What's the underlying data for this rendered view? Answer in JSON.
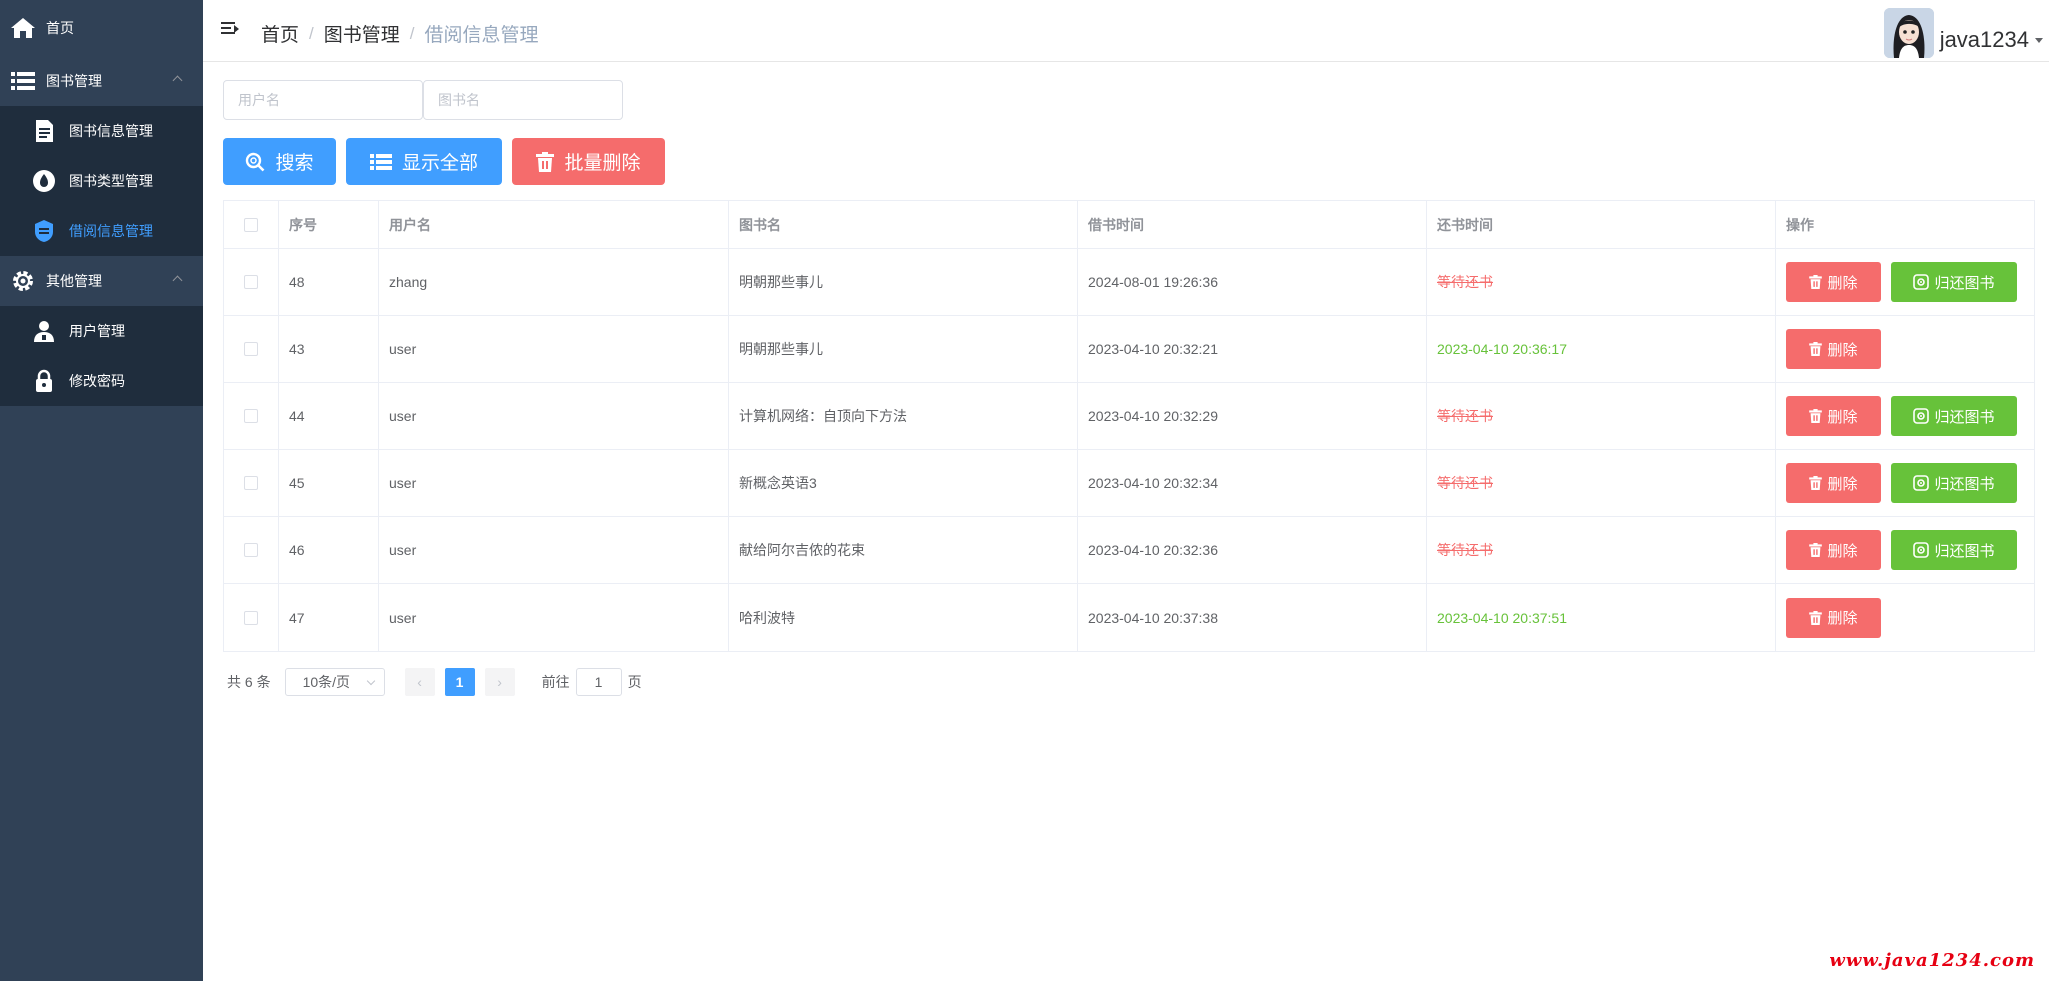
{
  "sidebar": {
    "items": [
      {
        "label": "首页"
      },
      {
        "label": "图书管理"
      },
      {
        "label": "图书信息管理"
      },
      {
        "label": "图书类型管理"
      },
      {
        "label": "借阅信息管理"
      },
      {
        "label": "其他管理"
      },
      {
        "label": "用户管理"
      },
      {
        "label": "修改密码"
      }
    ]
  },
  "header": {
    "breadcrumb": [
      "首页",
      "图书管理",
      "借阅信息管理"
    ],
    "separator": "/",
    "username": "java1234"
  },
  "filters": {
    "username_placeholder": "用户名",
    "bookname_placeholder": "图书名"
  },
  "toolbar": {
    "search_label": "搜索",
    "show_all_label": "显示全部",
    "batch_delete_label": "批量删除"
  },
  "table": {
    "headers": [
      "序号",
      "用户名",
      "图书名",
      "借书时间",
      "还书时间",
      "操作"
    ],
    "rows": [
      {
        "id": "48",
        "user": "zhang",
        "book": "明朝那些事儿",
        "borrow": "2024-08-01 19:26:36",
        "return": "等待还书"
      },
      {
        "id": "43",
        "user": "user",
        "book": "明朝那些事儿",
        "borrow": "2023-04-10 20:32:21",
        "return": "2023-04-10 20:36:17"
      },
      {
        "id": "44",
        "user": "user",
        "book": "计算机网络：自顶向下方法",
        "borrow": "2023-04-10 20:32:29",
        "return": "等待还书"
      },
      {
        "id": "45",
        "user": "user",
        "book": "新概念英语3",
        "borrow": "2023-04-10 20:32:34",
        "return": "等待还书"
      },
      {
        "id": "46",
        "user": "user",
        "book": "献给阿尔吉侬的花束",
        "borrow": "2023-04-10 20:32:36",
        "return": "等待还书"
      },
      {
        "id": "47",
        "user": "user",
        "book": "哈利波特",
        "borrow": "2023-04-10 20:37:38",
        "return": "2023-04-10 20:37:51"
      }
    ],
    "delete_label": "删除",
    "return_label": "归还图书"
  },
  "pagination": {
    "total": "共 6 条",
    "page_size": "10条/页",
    "prev": "‹",
    "next": "›",
    "current_page": "1",
    "goto_prefix": "前往",
    "goto_value": "1",
    "goto_suffix": "页"
  },
  "watermark": "www.java1234.com",
  "colors": {
    "sidebar_bg": "#304156",
    "submenu_bg": "#1f2d3d",
    "primary": "#409eff",
    "danger": "#f56c6c",
    "success": "#67c23a"
  }
}
